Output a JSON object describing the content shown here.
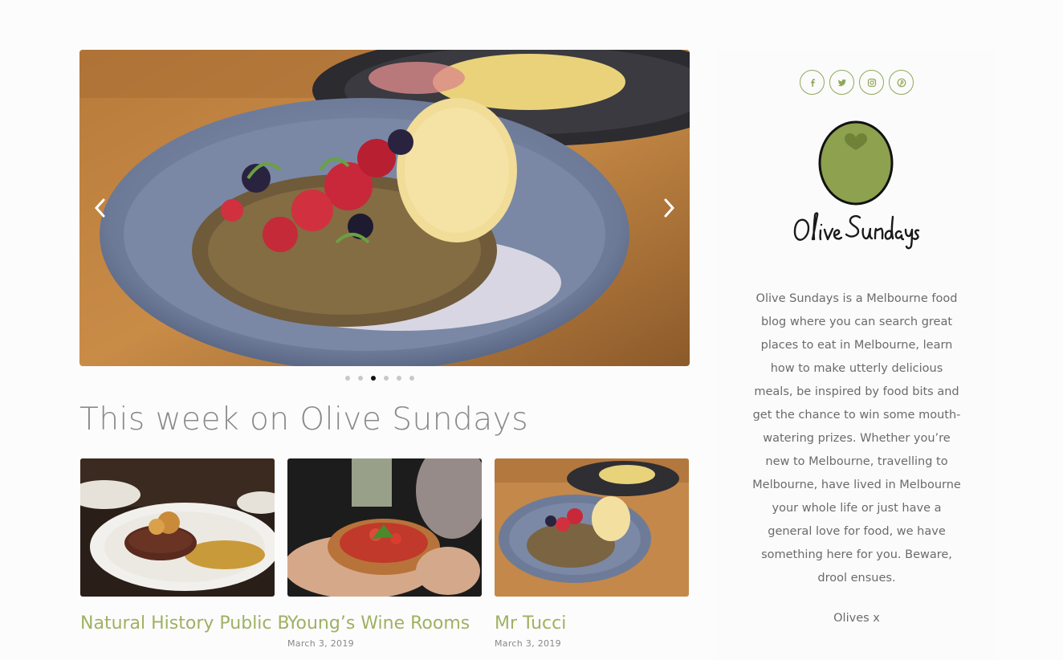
{
  "hero": {
    "prev_icon": "chevron-left-icon",
    "next_icon": "chevron-right-icon",
    "slide_count": 6,
    "active_slide": 3
  },
  "section_title": "This week on Olive Sundays",
  "posts": [
    {
      "title": "Natural History Public B",
      "date": ""
    },
    {
      "title": "Young’s Wine Rooms",
      "date": "March 3, 2019"
    },
    {
      "title": "Mr Tucci",
      "date": "March 3, 2019"
    }
  ],
  "sidebar": {
    "social_icons": [
      "facebook-icon",
      "twitter-icon",
      "instagram-icon",
      "pinterest-icon"
    ],
    "logo_text": "Olive Sundays",
    "about": "Olive Sundays is a Melbourne food blog where you can search great places to eat in Melbourne, learn how to make utterly delicious meals, be inspired by food bits and get the chance to win some mouth-watering prizes. Whether you’re new to Melbourne, travelling to Melbourne, have lived in Melbourne your whole life or just have a general love for food, we have something here for you. Beware, drool ensues.",
    "signoff": "Olives x"
  },
  "colors": {
    "accent_green": "#9fb162",
    "olive_fill": "#8da14e",
    "title_grey": "#8a8a8a"
  }
}
